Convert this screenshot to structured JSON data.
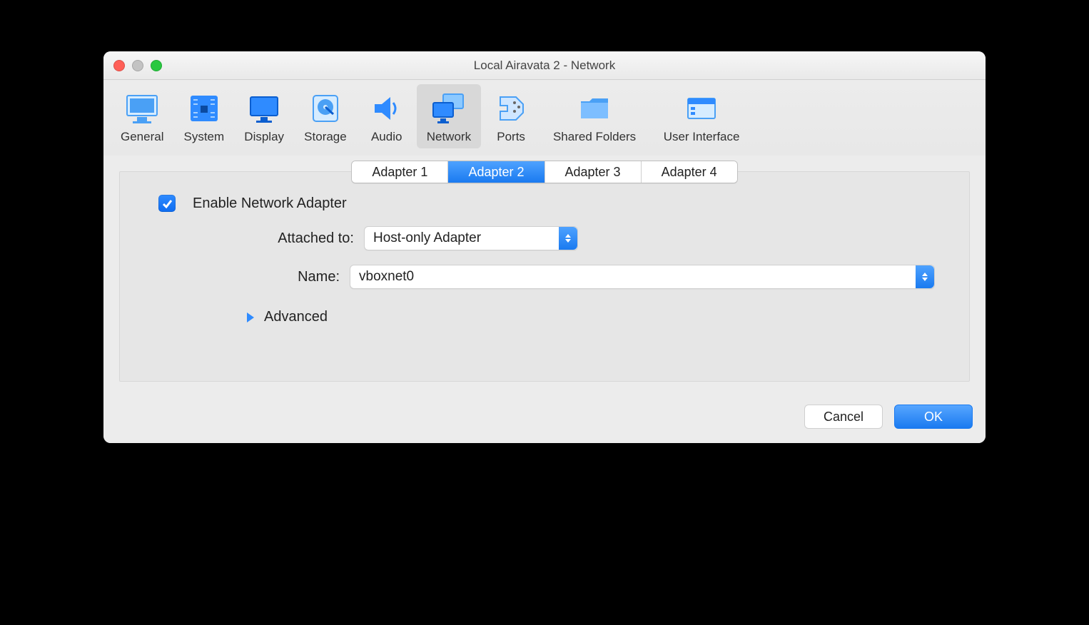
{
  "window": {
    "title": "Local Airavata 2 - Network"
  },
  "toolbar": {
    "items": [
      {
        "label": "General"
      },
      {
        "label": "System"
      },
      {
        "label": "Display"
      },
      {
        "label": "Storage"
      },
      {
        "label": "Audio"
      },
      {
        "label": "Network",
        "active": true
      },
      {
        "label": "Ports"
      },
      {
        "label": "Shared Folders"
      },
      {
        "label": "User Interface"
      }
    ]
  },
  "adapter_tabs": {
    "items": [
      {
        "label": "Adapter 1"
      },
      {
        "label": "Adapter 2",
        "active": true
      },
      {
        "label": "Adapter 3"
      },
      {
        "label": "Adapter 4"
      }
    ]
  },
  "form": {
    "enable_label": "Enable Network Adapter",
    "enable_checked": true,
    "attached_label": "Attached to:",
    "attached_value": "Host-only Adapter",
    "name_label": "Name:",
    "name_value": "vboxnet0",
    "advanced_label": "Advanced"
  },
  "footer": {
    "cancel": "Cancel",
    "ok": "OK"
  }
}
